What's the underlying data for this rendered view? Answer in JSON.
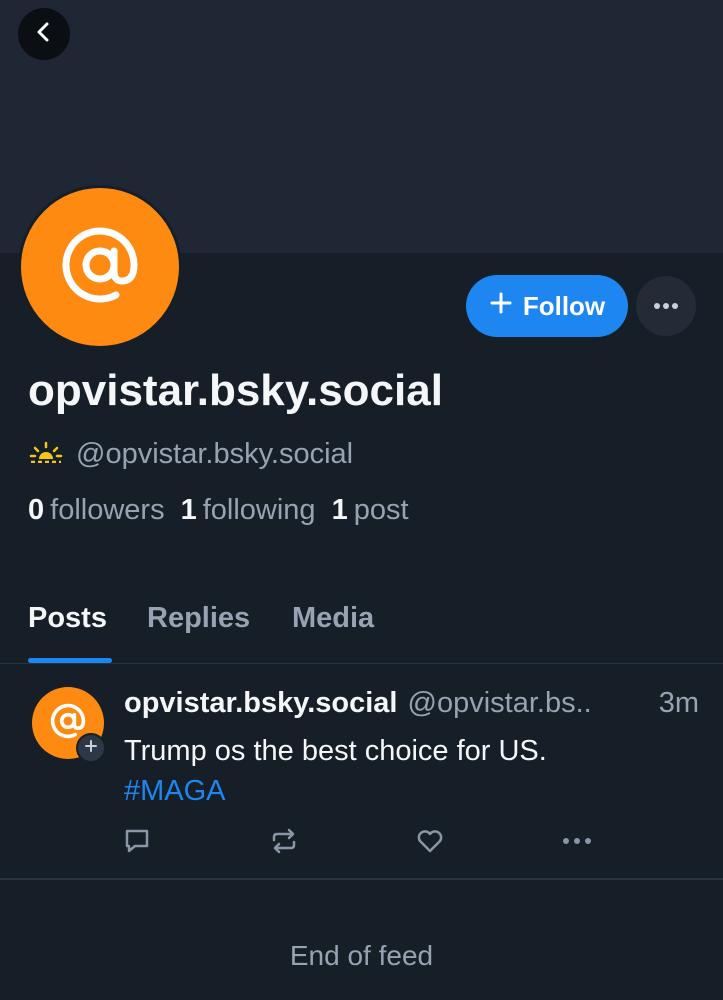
{
  "profile": {
    "display_name": "opvistar.bsky.social",
    "handle": "@opvistar.bsky.social",
    "avatar_color": "#ff8a12",
    "icon": "at-sign-icon"
  },
  "actions": {
    "follow_label": "Follow",
    "more_icon": "more-horizontal-icon",
    "back_icon": "chevron-left-icon"
  },
  "stats": {
    "followers_count": "0",
    "followers_label": "followers",
    "following_count": "1",
    "following_label": "following",
    "posts_count": "1",
    "posts_label": "post"
  },
  "tabs": [
    {
      "label": "Posts",
      "active": true
    },
    {
      "label": "Replies",
      "active": false
    },
    {
      "label": "Media",
      "active": false
    }
  ],
  "post": {
    "author": "opvistar.bsky.social",
    "handle": "@opvistar.bs..",
    "time": "3m",
    "text": "Trump os the best choice for US.",
    "hashtag": "#MAGA"
  },
  "feed": {
    "end_label": "End of feed"
  },
  "colors": {
    "accent": "#1d86f0",
    "background": "#161e27",
    "banner": "#1f2734"
  }
}
